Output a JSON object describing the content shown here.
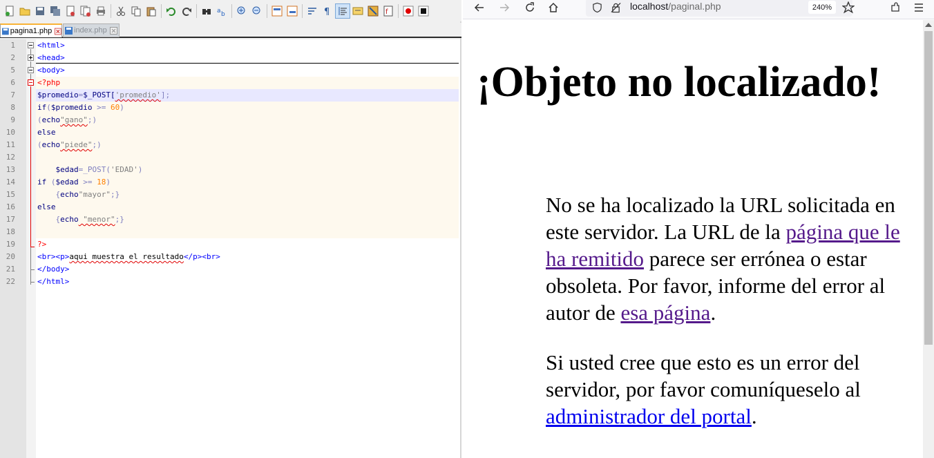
{
  "editor": {
    "tabs": [
      {
        "label": "pagina1.php",
        "active": true
      },
      {
        "label": "index.php",
        "active": false
      }
    ],
    "line_numbers": [
      "1",
      "2",
      "5",
      "6",
      "7",
      "8",
      "9",
      "10",
      "11",
      "12",
      "13",
      "14",
      "15",
      "16",
      "17",
      "18",
      "19",
      "20",
      "21",
      "22"
    ],
    "code": {
      "l1": "<html>",
      "l2": "<head>",
      "l5": "<body>",
      "l6": "<?php",
      "l7_a": "$promedio",
      "l7_b": "=",
      "l7_c": "$_POST[",
      "l7_d": "'promedio'",
      "l7_e": "];",
      "l8_a": "if",
      "l8_b": "(",
      "l8_c": "$promedio",
      "l8_d": " >= ",
      "l8_e": "60",
      "l8_f": ")",
      "l9_a": "(",
      "l9_b": "echo",
      "l9_c": "\"gano\"",
      "l9_d": ";)",
      "l10": "else",
      "l11_a": "(",
      "l11_b": "echo",
      "l11_c": "\"piede\"",
      "l11_d": ";)",
      "l13_a": "    $edad",
      "l13_b": "=_POST(",
      "l13_c": "'EDAD'",
      "l13_d": ")",
      "l14_a": "if",
      "l14_b": " (",
      "l14_c": "$edad",
      "l14_d": " >= ",
      "l14_e": "18",
      "l14_f": ")",
      "l15_a": "    {",
      "l15_b": "echo",
      "l15_c": "\"mayor\"",
      "l15_d": ";}",
      "l16": "else",
      "l17_a": "    {",
      "l17_b": "echo",
      "l17_c": " \"menor\"",
      "l17_d": ";}",
      "l19": "?>",
      "l20_a": "<br><p>",
      "l20_b": "aqui muestra el resultado",
      "l20_c": "</p><br>",
      "l21": "</body>",
      "l22": "</html>"
    }
  },
  "browser": {
    "url_host": "localhost",
    "url_path": "/paginal.php",
    "zoom": "240%",
    "page": {
      "title": "¡Objeto no localizado!",
      "p1_a": "No se ha localizado la URL solicitada en este servidor. La URL de la ",
      "p1_link1": "página que le ha remitido",
      "p1_b": " parece ser errónea o estar obsoleta. Por favor, informe del error al autor de ",
      "p1_link2": "esa página",
      "p1_c": ".",
      "p2_a": "Si usted cree que esto es un error del servidor, por favor comuníqueselo al ",
      "p2_link": "administrador del portal",
      "p2_b": "."
    }
  },
  "colors": {
    "php_bg": "#fef9ee",
    "current_line": "#e8e8ff",
    "link": "#0000ee",
    "link_visited": "#551a8b"
  }
}
